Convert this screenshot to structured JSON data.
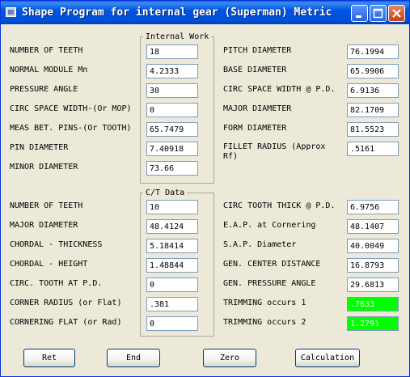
{
  "window": {
    "title": "Shape Program for internal gear (Superman)  Metric"
  },
  "internal_work": {
    "group_title": "Internal Work",
    "left": [
      {
        "label": "NUMBER OF TEETH",
        "value": "18"
      },
      {
        "label": "NORMAL MODULE  Mn",
        "value": "4.2333"
      },
      {
        "label": "PRESSURE ANGLE",
        "value": "30"
      },
      {
        "label": "CIRC SPACE WIDTH-(Or MOP)",
        "value": "0"
      },
      {
        "label": "MEAS BET. PINS-(Or TOOTH)",
        "value": "65.7479"
      },
      {
        "label": "PIN DIAMETER",
        "value": "7.40918"
      },
      {
        "label": "MINOR DIAMETER",
        "value": "73.66"
      }
    ],
    "right": [
      {
        "label": "PITCH DIAMETER",
        "value": "76.1994"
      },
      {
        "label": "BASE DIAMETER",
        "value": "65.9906"
      },
      {
        "label": "CIRC SPACE WIDTH @ P.D.",
        "value": "6.9136"
      },
      {
        "label": "MAJOR DIAMETER",
        "value": "82.1709"
      },
      {
        "label": "FORM DIAMETER",
        "value": "81.5523"
      },
      {
        "label": "FILLET RADIUS (Approx Rf)",
        "value": ".5161"
      }
    ]
  },
  "ct_data": {
    "group_title": "C/T Data",
    "left": [
      {
        "label": "NUMBER OF TEETH",
        "value": "10"
      },
      {
        "label": "MAJOR DIAMETER",
        "value": "48.4124"
      },
      {
        "label": "CHORDAL - THICKNESS",
        "value": "5.18414"
      },
      {
        "label": "CHORDAL - HEIGHT",
        "value": "1.48844"
      },
      {
        "label": "CIRC. TOOTH AT P.D.",
        "value": "0"
      },
      {
        "label": "CORNER RADIUS (or Flat)",
        "value": ".381"
      },
      {
        "label": "CORNERING FLAT (or Rad)",
        "value": "0"
      }
    ],
    "right": [
      {
        "label": "CIRC TOOTH THICK @ P.D.",
        "value": "6.9756"
      },
      {
        "label": "E.A.P. at Cornering",
        "value": "48.1407"
      },
      {
        "label": "S.A.P. Diameter",
        "value": "40.0049"
      },
      {
        "label": "GEN. CENTER DISTANCE",
        "value": "16.8793"
      },
      {
        "label": "GEN. PRESSURE ANGLE",
        "value": "29.6813"
      },
      {
        "label": "TRIMMING occurs 1",
        "value": ".7633"
      },
      {
        "label": "TRIMMING occurs 2",
        "value": "1.2791"
      }
    ]
  },
  "buttons": {
    "ret": "Ret",
    "end": "End",
    "zero": "Zero",
    "calculation": "Calculation"
  },
  "colors": {
    "trimming_highlight": "#00ff00",
    "titlebar": "#0054e3"
  },
  "icons": [
    "app-icon",
    "minimize-icon",
    "maximize-icon",
    "close-icon"
  ]
}
